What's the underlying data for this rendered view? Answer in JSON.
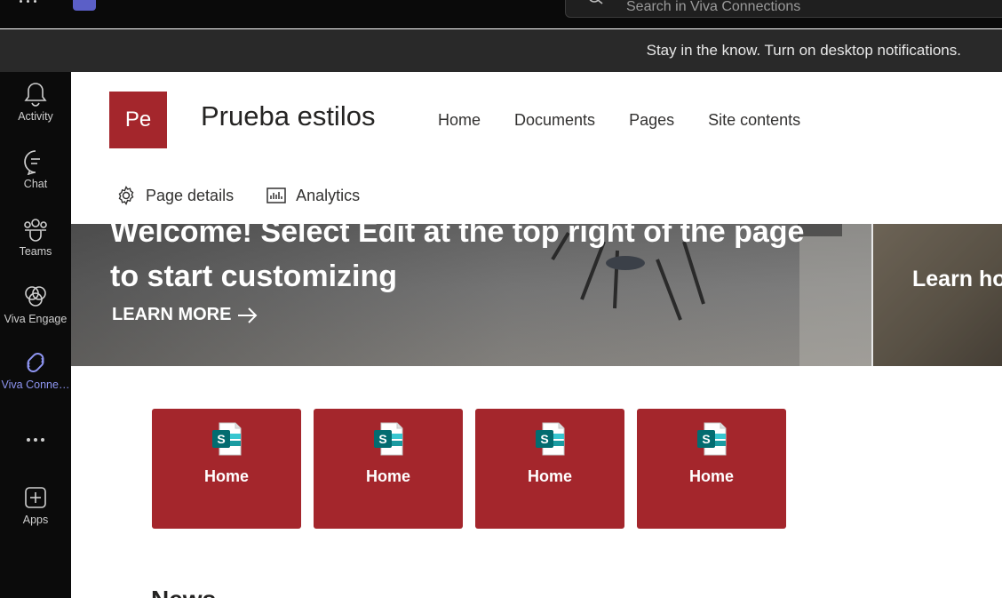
{
  "topbar": {
    "search_placeholder": "Search in Viva Connections"
  },
  "notification": {
    "text": "Stay in the know. Turn on desktop notifications."
  },
  "rail": {
    "items": [
      {
        "label": "Activity",
        "icon": "bell-icon"
      },
      {
        "label": "Chat",
        "icon": "chat-icon"
      },
      {
        "label": "Teams",
        "icon": "teams-icon"
      },
      {
        "label": "Viva Engage",
        "icon": "viva-engage-icon"
      },
      {
        "label": "Viva Conne…",
        "icon": "viva-connections-icon",
        "active": true
      },
      {
        "label": "",
        "icon": "more-icon"
      },
      {
        "label": "Apps",
        "icon": "apps-icon"
      }
    ]
  },
  "site": {
    "logo_text": "Pe",
    "title": "Prueba estilos",
    "nav": [
      "Home",
      "Documents",
      "Pages",
      "Site contents"
    ]
  },
  "commandbar": {
    "page_details": "Page details",
    "analytics": "Analytics"
  },
  "hero": {
    "title": "Welcome! Select Edit at the top right of the page to start customizing",
    "link": "LEARN MORE",
    "side_title": "Learn how to use web parts"
  },
  "quicklinks": {
    "tiles": [
      {
        "label": "Home",
        "icon": "sharepoint-icon"
      },
      {
        "label": "Home",
        "icon": "sharepoint-icon"
      },
      {
        "label": "Home",
        "icon": "sharepoint-icon"
      },
      {
        "label": "Home",
        "icon": "sharepoint-icon"
      }
    ]
  },
  "news": {
    "heading": "News"
  },
  "colors": {
    "accent": "#a4262c",
    "rail_active": "#8e95f2",
    "topbar": "#0a0a0a",
    "notification_bar": "#292929"
  }
}
